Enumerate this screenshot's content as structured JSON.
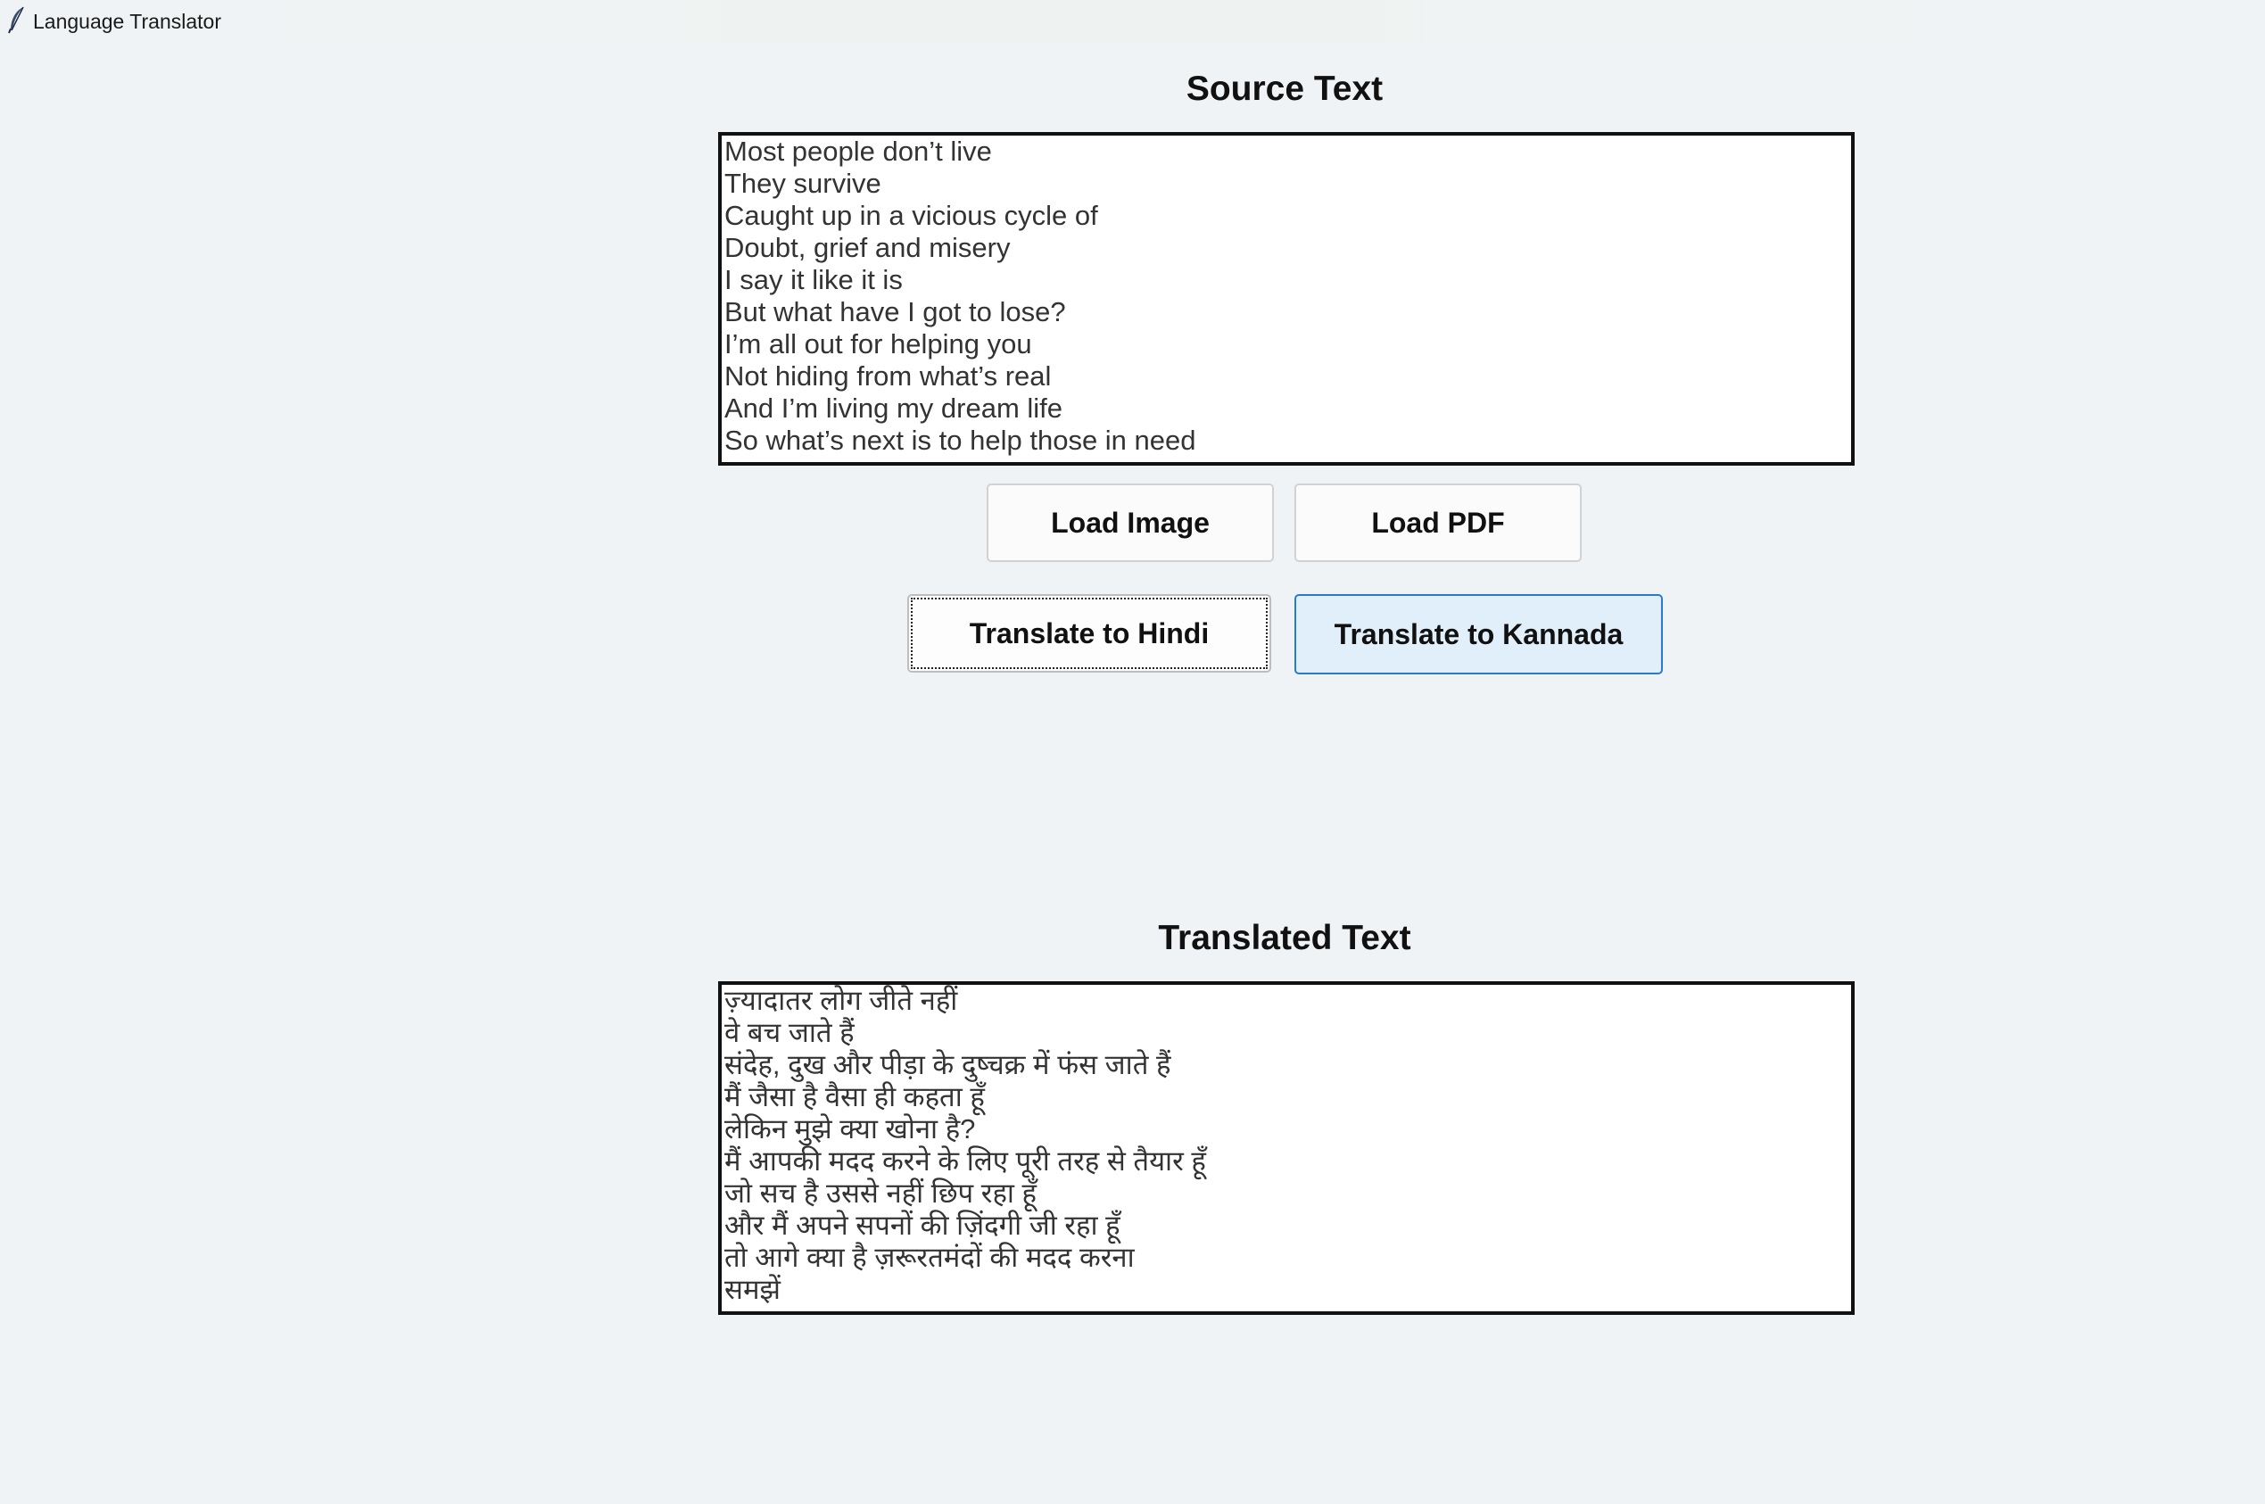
{
  "window": {
    "title": "Language Translator",
    "icon": "feather-icon"
  },
  "source": {
    "title": "Source Text",
    "lines": [
      "Most people don’t live",
      "They survive",
      "Caught up in a vicious cycle of",
      "Doubt, grief and misery",
      "I say it like it is",
      "But what have I got to lose?",
      "I’m all out for helping you",
      "Not hiding from what’s real",
      "And I’m living my dream life",
      "So what’s next is to help those in need"
    ]
  },
  "buttons": {
    "load_image": "Load Image",
    "load_pdf": "Load PDF",
    "translate_hindi": "Translate to Hindi",
    "translate_kannada": "Translate to Kannada"
  },
  "translated": {
    "title": "Translated Text",
    "lines": [
      "ज़्यादातर लोग जीते नहीं",
      "वे बच जाते हैं",
      "संदेह, दुख और पीड़ा के दुष्चक्र में फंस जाते हैं",
      "मैं जैसा है वैसा ही कहता हूँ",
      "लेकिन मुझे क्या खोना है?",
      "मैं आपकी मदद करने के लिए पूरी तरह से तैयार हूँ",
      "जो सच है उससे नहीं छिप रहा हूँ",
      "और मैं अपने सपनों की ज़िंदगी जी रहा हूँ",
      "तो आगे क्या है ज़रूरतमंदों की मदद करना",
      "समझें"
    ]
  },
  "colors": {
    "background": "#f0f3f5",
    "button_hover_bg": "#e1effb",
    "button_hover_border": "#2a7bd0"
  }
}
